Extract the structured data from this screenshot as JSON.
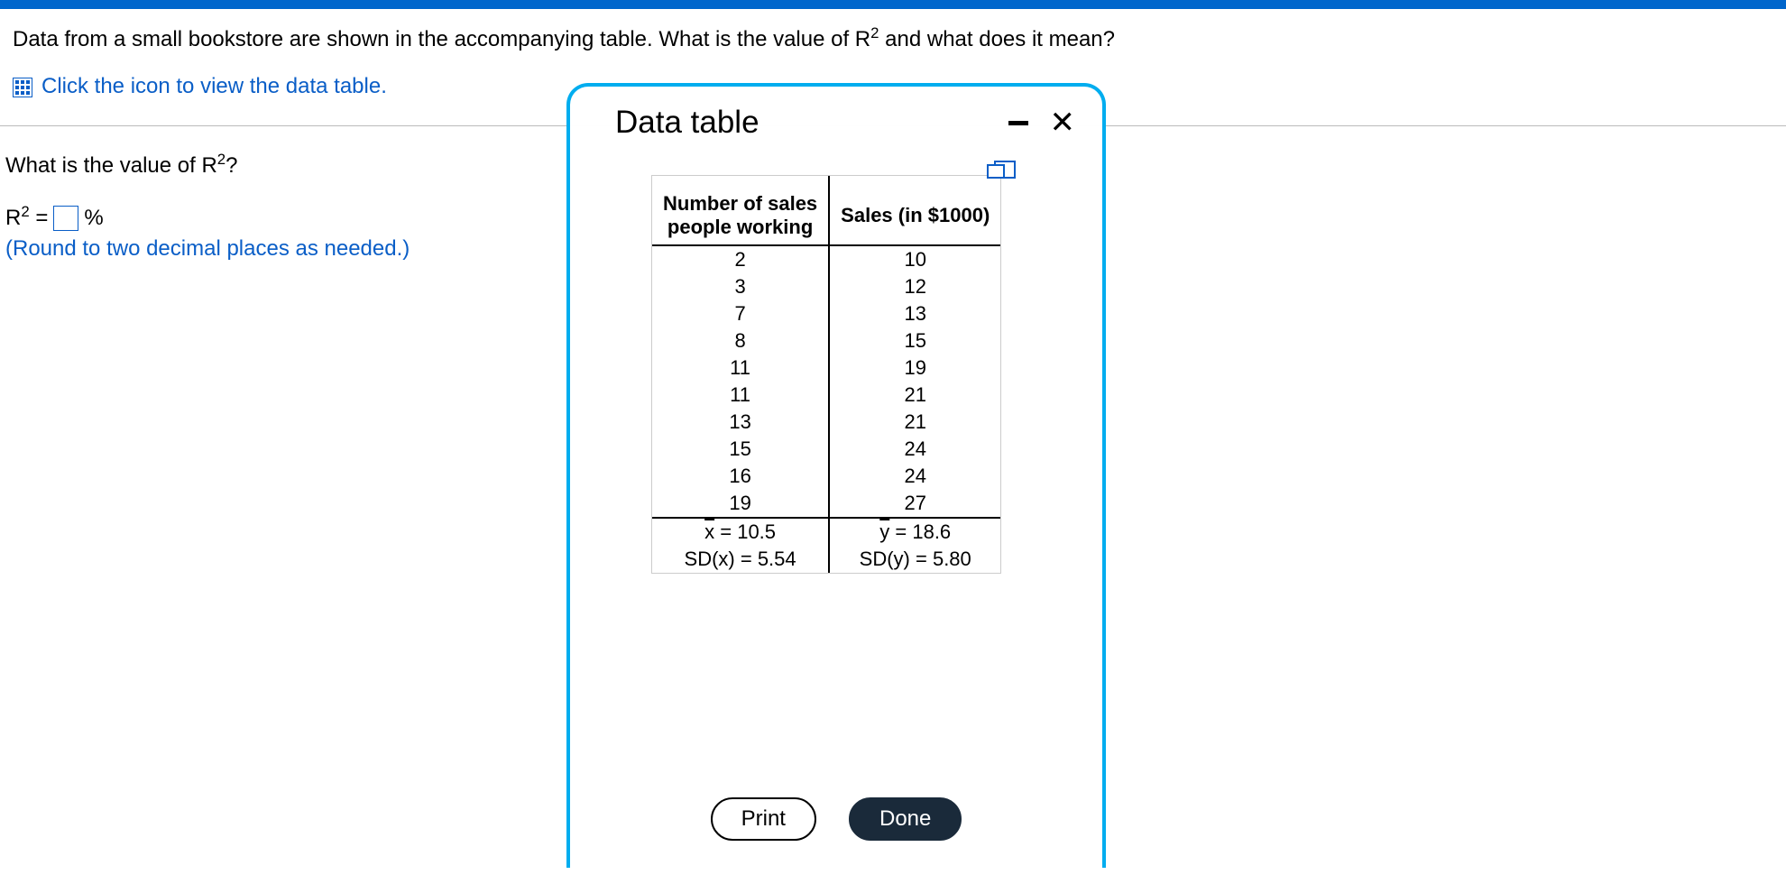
{
  "question": {
    "prompt_before": "Data from a small bookstore are shown in the accompanying table. What is the value of R",
    "prompt_sup": "2",
    "prompt_after": " and what does it mean?",
    "link_text": "Click the icon to view the data table."
  },
  "answer": {
    "subq_before": "What is the value of R",
    "subq_sup": "2",
    "subq_after": "?",
    "expr_before": "R",
    "expr_sup": "2",
    "expr_eq": " = ",
    "expr_unit": "%",
    "input_value": "",
    "hint": "(Round to two decimal places as needed.)"
  },
  "modal": {
    "title": "Data table",
    "col1_header_l1": "Number of sales",
    "col1_header_l2": "people working",
    "col2_header": "Sales (in $1000)",
    "rows": [
      {
        "x": "2",
        "y": "10"
      },
      {
        "x": "3",
        "y": "12"
      },
      {
        "x": "7",
        "y": "13"
      },
      {
        "x": "8",
        "y": "15"
      },
      {
        "x": "11",
        "y": "19"
      },
      {
        "x": "11",
        "y": "21"
      },
      {
        "x": "13",
        "y": "21"
      },
      {
        "x": "15",
        "y": "24"
      },
      {
        "x": "16",
        "y": "24"
      },
      {
        "x": "19",
        "y": "27"
      }
    ],
    "xbar": "x = 10.5",
    "ybar": "y = 18.6",
    "sdx": "SD(x) = 5.54",
    "sdy": "SD(y) = 5.80",
    "print_label": "Print",
    "done_label": "Done"
  }
}
